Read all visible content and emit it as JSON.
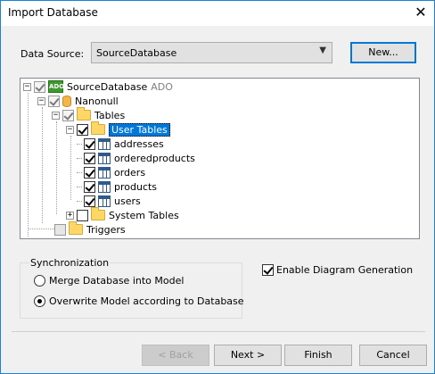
{
  "window": {
    "title": "Import Database",
    "close_glyph": "✕"
  },
  "data_source": {
    "label": "Data Source:",
    "value": "SourceDatabase",
    "new_button": "New..."
  },
  "tree": {
    "root": {
      "label": "SourceDatabase",
      "suffix": "ADO",
      "icon": "ado-database-icon"
    },
    "db": {
      "label": "Nanonull"
    },
    "tables": {
      "label": "Tables"
    },
    "user_tables": {
      "label": "User Tables"
    },
    "items": [
      "addresses",
      "orderedproducts",
      "orders",
      "products",
      "users"
    ],
    "system_tables": {
      "label": "System Tables"
    },
    "triggers": {
      "label": "Triggers"
    }
  },
  "sync": {
    "title": "Synchronization",
    "option_merge": "Merge Database into Model",
    "option_overwrite": "Overwrite Model according to Database",
    "selected": "overwrite"
  },
  "diagram": {
    "label": "Enable Diagram Generation",
    "checked": true
  },
  "buttons": {
    "back_label": "< Back",
    "next_label": "Next >",
    "finish_label": "Finish",
    "cancel_label": "Cancel"
  }
}
